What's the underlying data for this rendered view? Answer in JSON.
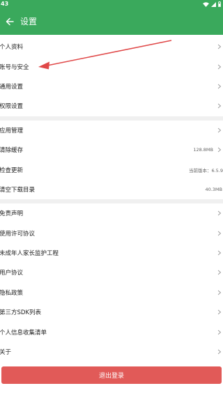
{
  "status_bar": {
    "time": "43",
    "icons": [
      "wifi-icon",
      "signal-icon",
      "battery-icon"
    ]
  },
  "header": {
    "title": "设置",
    "back_icon": "back-arrow-icon"
  },
  "groups": [
    {
      "items": [
        {
          "label": "个人资料"
        },
        {
          "label": "账号与安全"
        },
        {
          "label": "通用设置"
        },
        {
          "label": "权限设置"
        }
      ]
    },
    {
      "items": [
        {
          "label": "应用管理"
        },
        {
          "label": "清除缓存",
          "value": "128.8MB"
        },
        {
          "label": "检查更新",
          "value": "当前版本：6.5.9"
        },
        {
          "label": "清空下载目录",
          "value": "40.3MB"
        }
      ]
    },
    {
      "items": [
        {
          "label": "免责声明"
        },
        {
          "label": "使用许可协议"
        },
        {
          "label": "未成年人家长监护工程"
        },
        {
          "label": "用户协议"
        },
        {
          "label": "隐私政策"
        },
        {
          "label": "第三方SDK列表"
        },
        {
          "label": "个人信息收集清单"
        },
        {
          "label": "关于"
        }
      ]
    }
  ],
  "logout_label": "退出登录",
  "colors": {
    "primary": "#3aa95c",
    "logout": "#e15a58",
    "annotation_arrow": "#e04848"
  }
}
